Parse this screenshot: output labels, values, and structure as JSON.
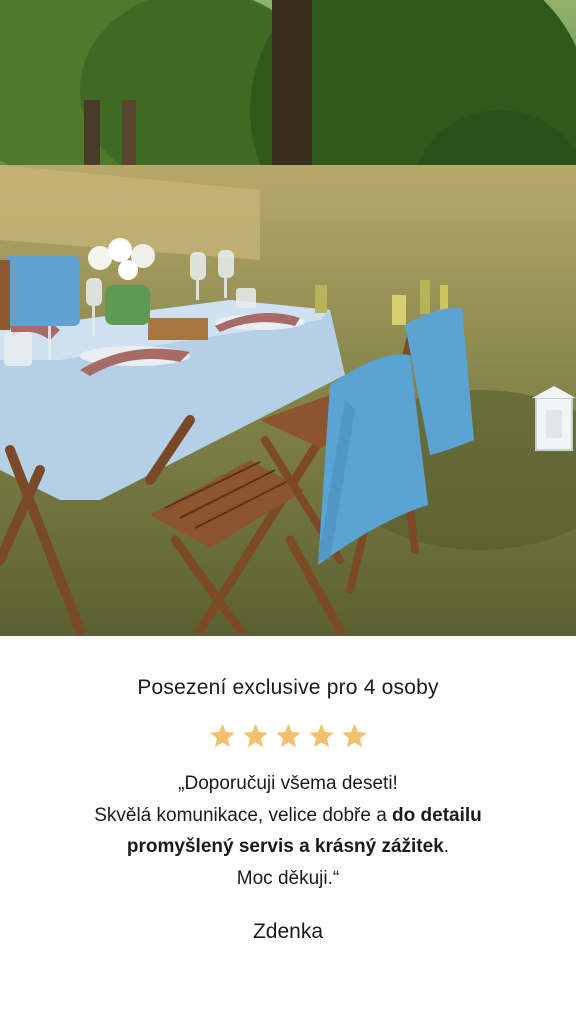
{
  "photo": {
    "description_icon": "picnic-photo"
  },
  "review": {
    "title": "Posezení exclusive pro 4 osoby",
    "rating": 5,
    "rating_max": 5,
    "star_color": "#F3C06B",
    "quote_line1": "„Doporučuji všema deseti!",
    "quote_line2_plain": "Skvělá komunikace, velice dobře a ",
    "quote_line2_bold": "do detailu",
    "quote_line3_bold": "promyšlený servis a krásný zážitek",
    "quote_line3_end": ".",
    "quote_line4": "Moc děkuji.“",
    "author": "Zdenka"
  }
}
